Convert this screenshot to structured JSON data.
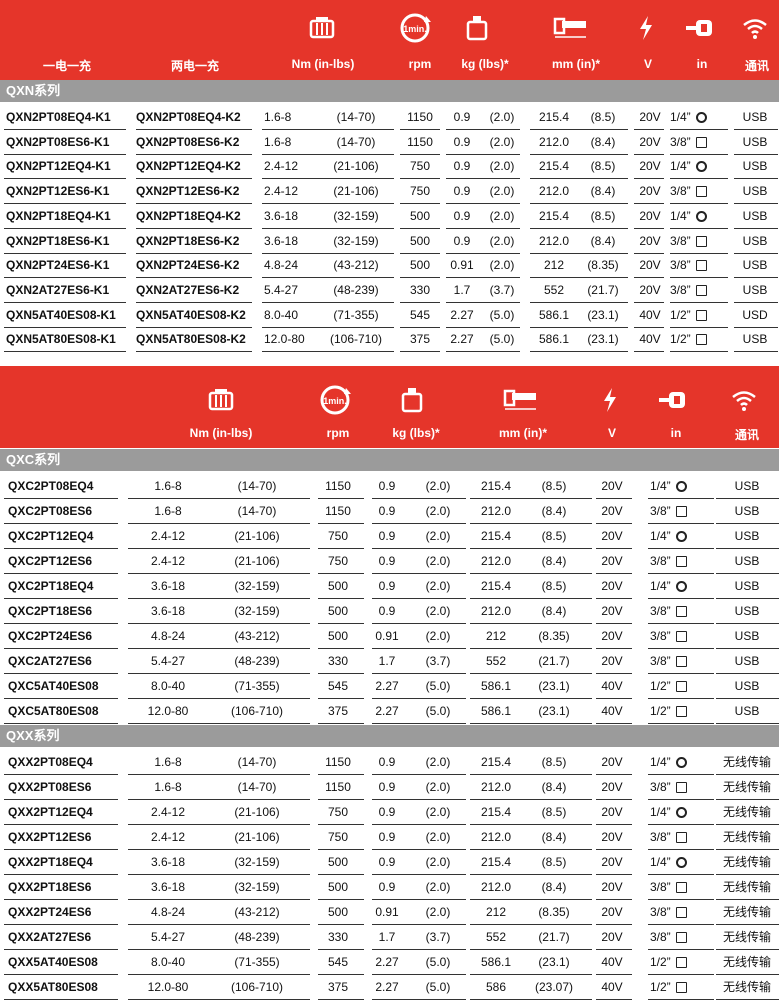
{
  "headers1": {
    "col_a": "一电一充",
    "col_b": "两电一充",
    "nm": "Nm (in-lbs)",
    "rpm": "rpm",
    "kg": "kg (lbs)*",
    "mm": "mm (in)*",
    "v": "V",
    "in": "in",
    "comm": "通讯"
  },
  "headers2": {
    "nm": "Nm (in-lbs)",
    "rpm": "rpm",
    "kg": "kg (lbs)*",
    "mm": "mm (in)*",
    "v": "V",
    "in": "in",
    "comm": "通讯"
  },
  "icons": {
    "min_label": "1min."
  },
  "qxn": {
    "title": "QXN系列",
    "rows": [
      {
        "a": "QXN2PT08EQ4-K1",
        "b": "QXN2PT08EQ4-K2",
        "nm": "1.6-8",
        "inlb": "(14-70)",
        "rpm": "1150",
        "kg": "0.9",
        "lbs": "(2.0)",
        "mm": "215.4",
        "inch": "(8.5)",
        "v": "20V",
        "drive": "1/4”",
        "sym": "ring",
        "comm": "USB"
      },
      {
        "a": "QXN2PT08ES6-K1",
        "b": "QXN2PT08ES6-K2",
        "nm": "1.6-8",
        "inlb": "(14-70)",
        "rpm": "1150",
        "kg": "0.9",
        "lbs": "(2.0)",
        "mm": "212.0",
        "inch": "(8.4)",
        "v": "20V",
        "drive": "3/8”",
        "sym": "sq",
        "comm": "USB"
      },
      {
        "a": "QXN2PT12EQ4-K1",
        "b": "QXN2PT12EQ4-K2",
        "nm": "2.4-12",
        "inlb": "(21-106)",
        "rpm": "750",
        "kg": "0.9",
        "lbs": "(2.0)",
        "mm": "215.4",
        "inch": "(8.5)",
        "v": "20V",
        "drive": "1/4”",
        "sym": "ring",
        "comm": "USB"
      },
      {
        "a": "QXN2PT12ES6-K1",
        "b": "QXN2PT12ES6-K2",
        "nm": "2.4-12",
        "inlb": "(21-106)",
        "rpm": "750",
        "kg": "0.9",
        "lbs": "(2.0)",
        "mm": "212.0",
        "inch": "(8.4)",
        "v": "20V",
        "drive": "3/8”",
        "sym": "sq",
        "comm": "USB"
      },
      {
        "a": "QXN2PT18EQ4-K1",
        "b": "QXN2PT18EQ4-K2",
        "nm": "3.6-18",
        "inlb": "(32-159)",
        "rpm": "500",
        "kg": "0.9",
        "lbs": "(2.0)",
        "mm": "215.4",
        "inch": "(8.5)",
        "v": "20V",
        "drive": "1/4”",
        "sym": "ring",
        "comm": "USB"
      },
      {
        "a": "QXN2PT18ES6-K1",
        "b": "QXN2PT18ES6-K2",
        "nm": "3.6-18",
        "inlb": "(32-159)",
        "rpm": "500",
        "kg": "0.9",
        "lbs": "(2.0)",
        "mm": "212.0",
        "inch": "(8.4)",
        "v": "20V",
        "drive": "3/8”",
        "sym": "sq",
        "comm": "USB"
      },
      {
        "a": "QXN2PT24ES6-K1",
        "b": "QXN2PT24ES6-K2",
        "nm": "4.8-24",
        "inlb": "(43-212)",
        "rpm": "500",
        "kg": "0.91",
        "lbs": "(2.0)",
        "mm": "212",
        "inch": "(8.35)",
        "v": "20V",
        "drive": "3/8”",
        "sym": "sq",
        "comm": "USB"
      },
      {
        "a": "QXN2AT27ES6-K1",
        "b": "QXN2AT27ES6-K2",
        "nm": "5.4-27",
        "inlb": "(48-239)",
        "rpm": "330",
        "kg": "1.7",
        "lbs": "(3.7)",
        "mm": "552",
        "inch": "(21.7)",
        "v": "20V",
        "drive": "3/8”",
        "sym": "sq",
        "comm": "USB"
      },
      {
        "a": "QXN5AT40ES08-K1",
        "b": "QXN5AT40ES08-K2",
        "nm": "8.0-40",
        "inlb": "(71-355)",
        "rpm": "545",
        "kg": "2.27",
        "lbs": "(5.0)",
        "mm": "586.1",
        "inch": "(23.1)",
        "v": "40V",
        "drive": "1/2”",
        "sym": "sq",
        "comm": "USD"
      },
      {
        "a": "QXN5AT80ES08-K1",
        "b": "QXN5AT80ES08-K2",
        "nm": "12.0-80",
        "inlb": "(106-710)",
        "rpm": "375",
        "kg": "2.27",
        "lbs": "(5.0)",
        "mm": "586.1",
        "inch": "(23.1)",
        "v": "40V",
        "drive": "1/2”",
        "sym": "sq",
        "comm": "USB"
      }
    ]
  },
  "qxc": {
    "title": "QXC系列",
    "rows": [
      {
        "a": "QXC2PT08EQ4",
        "nm": "1.6-8",
        "inlb": "(14-70)",
        "rpm": "1150",
        "kg": "0.9",
        "lbs": "(2.0)",
        "mm": "215.4",
        "inch": "(8.5)",
        "v": "20V",
        "drive": "1/4”",
        "sym": "ring",
        "comm": "USB"
      },
      {
        "a": "QXC2PT08ES6",
        "nm": "1.6-8",
        "inlb": "(14-70)",
        "rpm": "1150",
        "kg": "0.9",
        "lbs": "(2.0)",
        "mm": "212.0",
        "inch": "(8.4)",
        "v": "20V",
        "drive": "3/8”",
        "sym": "sq",
        "comm": "USB"
      },
      {
        "a": "QXC2PT12EQ4",
        "nm": "2.4-12",
        "inlb": "(21-106)",
        "rpm": "750",
        "kg": "0.9",
        "lbs": "(2.0)",
        "mm": "215.4",
        "inch": "(8.5)",
        "v": "20V",
        "drive": "1/4”",
        "sym": "ring",
        "comm": "USB"
      },
      {
        "a": "QXC2PT12ES6",
        "nm": "2.4-12",
        "inlb": "(21-106)",
        "rpm": "750",
        "kg": "0.9",
        "lbs": "(2.0)",
        "mm": "212.0",
        "inch": "(8.4)",
        "v": "20V",
        "drive": "3/8”",
        "sym": "sq",
        "comm": "USB"
      },
      {
        "a": "QXC2PT18EQ4",
        "nm": "3.6-18",
        "inlb": "(32-159)",
        "rpm": "500",
        "kg": "0.9",
        "lbs": "(2.0)",
        "mm": "215.4",
        "inch": "(8.5)",
        "v": "20V",
        "drive": "1/4”",
        "sym": "ring",
        "comm": "USB"
      },
      {
        "a": "QXC2PT18ES6",
        "nm": "3.6-18",
        "inlb": "(32-159)",
        "rpm": "500",
        "kg": "0.9",
        "lbs": "(2.0)",
        "mm": "212.0",
        "inch": "(8.4)",
        "v": "20V",
        "drive": "3/8”",
        "sym": "sq",
        "comm": "USB"
      },
      {
        "a": "QXC2PT24ES6",
        "nm": "4.8-24",
        "inlb": "(43-212)",
        "rpm": "500",
        "kg": "0.91",
        "lbs": "(2.0)",
        "mm": "212",
        "inch": "(8.35)",
        "v": "20V",
        "drive": "3/8”",
        "sym": "sq",
        "comm": "USB"
      },
      {
        "a": "QXC2AT27ES6",
        "nm": "5.4-27",
        "inlb": "(48-239)",
        "rpm": "330",
        "kg": "1.7",
        "lbs": "(3.7)",
        "mm": "552",
        "inch": "(21.7)",
        "v": "20V",
        "drive": "3/8”",
        "sym": "sq",
        "comm": "USB"
      },
      {
        "a": "QXC5AT40ES08",
        "nm": "8.0-40",
        "inlb": "(71-355)",
        "rpm": "545",
        "kg": "2.27",
        "lbs": "(5.0)",
        "mm": "586.1",
        "inch": "(23.1)",
        "v": "40V",
        "drive": "1/2”",
        "sym": "sq",
        "comm": "USB"
      },
      {
        "a": "QXC5AT80ES08",
        "nm": "12.0-80",
        "inlb": "(106-710)",
        "rpm": "375",
        "kg": "2.27",
        "lbs": "(5.0)",
        "mm": "586.1",
        "inch": "(23.1)",
        "v": "40V",
        "drive": "1/2”",
        "sym": "sq",
        "comm": "USB"
      }
    ]
  },
  "qxx": {
    "title": "QXX系列",
    "rows": [
      {
        "a": "QXX2PT08EQ4",
        "nm": "1.6-8",
        "inlb": "(14-70)",
        "rpm": "1150",
        "kg": "0.9",
        "lbs": "(2.0)",
        "mm": "215.4",
        "inch": "(8.5)",
        "v": "20V",
        "drive": "1/4”",
        "sym": "ring",
        "comm": "无线传输"
      },
      {
        "a": "QXX2PT08ES6",
        "nm": "1.6-8",
        "inlb": "(14-70)",
        "rpm": "1150",
        "kg": "0.9",
        "lbs": "(2.0)",
        "mm": "212.0",
        "inch": "(8.4)",
        "v": "20V",
        "drive": "3/8”",
        "sym": "sq",
        "comm": "无线传输"
      },
      {
        "a": "QXX2PT12EQ4",
        "nm": "2.4-12",
        "inlb": "(21-106)",
        "rpm": "750",
        "kg": "0.9",
        "lbs": "(2.0)",
        "mm": "215.4",
        "inch": "(8.5)",
        "v": "20V",
        "drive": "1/4”",
        "sym": "ring",
        "comm": "无线传输"
      },
      {
        "a": "QXX2PT12ES6",
        "nm": "2.4-12",
        "inlb": "(21-106)",
        "rpm": "750",
        "kg": "0.9",
        "lbs": "(2.0)",
        "mm": "212.0",
        "inch": "(8.4)",
        "v": "20V",
        "drive": "3/8”",
        "sym": "sq",
        "comm": "无线传输"
      },
      {
        "a": "QXX2PT18EQ4",
        "nm": "3.6-18",
        "inlb": "(32-159)",
        "rpm": "500",
        "kg": "0.9",
        "lbs": "(2.0)",
        "mm": "215.4",
        "inch": "(8.5)",
        "v": "20V",
        "drive": "1/4”",
        "sym": "ring",
        "comm": "无线传输"
      },
      {
        "a": "QXX2PT18ES6",
        "nm": "3.6-18",
        "inlb": "(32-159)",
        "rpm": "500",
        "kg": "0.9",
        "lbs": "(2.0)",
        "mm": "212.0",
        "inch": "(8.4)",
        "v": "20V",
        "drive": "3/8”",
        "sym": "sq",
        "comm": "无线传输"
      },
      {
        "a": "QXX2PT24ES6",
        "nm": "4.8-24",
        "inlb": "(43-212)",
        "rpm": "500",
        "kg": "0.91",
        "lbs": "(2.0)",
        "mm": "212",
        "inch": "(8.35)",
        "v": "20V",
        "drive": "3/8”",
        "sym": "sq",
        "comm": "无线传输"
      },
      {
        "a": "QXX2AT27ES6",
        "nm": "5.4-27",
        "inlb": "(48-239)",
        "rpm": "330",
        "kg": "1.7",
        "lbs": "(3.7)",
        "mm": "552",
        "inch": "(21.7)",
        "v": "20V",
        "drive": "3/8”",
        "sym": "sq",
        "comm": "无线传输"
      },
      {
        "a": "QXX5AT40ES08",
        "nm": "8.0-40",
        "inlb": "(71-355)",
        "rpm": "545",
        "kg": "2.27",
        "lbs": "(5.0)",
        "mm": "586.1",
        "inch": "(23.1)",
        "v": "40V",
        "drive": "1/2”",
        "sym": "sq",
        "comm": "无线传输"
      },
      {
        "a": "QXX5AT80ES08",
        "nm": "12.0-80",
        "inlb": "(106-710)",
        "rpm": "375",
        "kg": "2.27",
        "lbs": "(5.0)",
        "mm": "586",
        "inch": "(23.07)",
        "v": "40V",
        "drive": "1/2”",
        "sym": "sq",
        "comm": "无线传输"
      }
    ]
  }
}
